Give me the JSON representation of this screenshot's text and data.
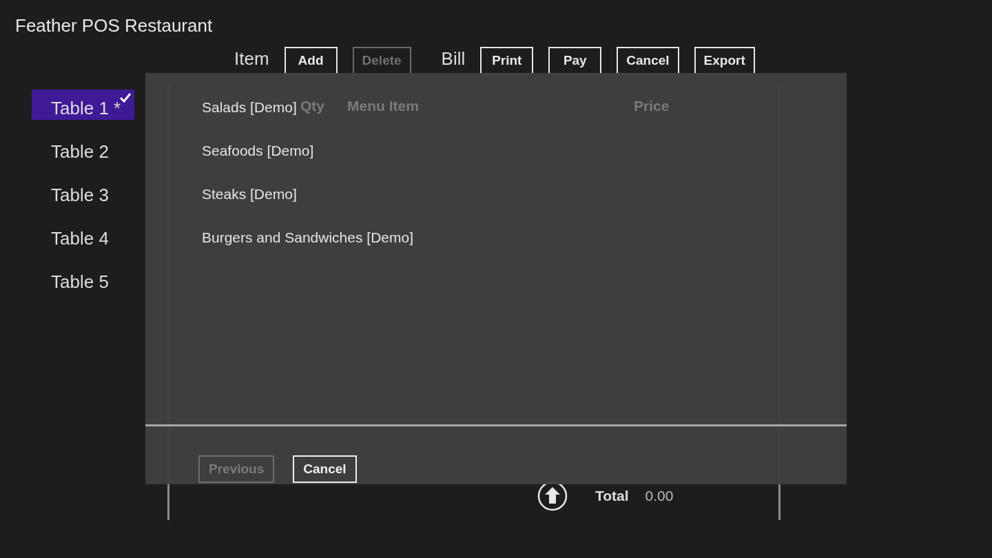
{
  "window": {
    "title": "Feather POS Restaurant"
  },
  "toolbar": {
    "groups": [
      {
        "label": "Item",
        "buttons": [
          {
            "label": "Add",
            "disabled": false
          },
          {
            "label": "Delete",
            "disabled": true
          }
        ]
      },
      {
        "label": "Bill",
        "buttons": [
          {
            "label": "Print",
            "disabled": false
          },
          {
            "label": "Pay",
            "disabled": false
          },
          {
            "label": "Cancel",
            "disabled": false
          },
          {
            "label": "Export",
            "disabled": false
          }
        ]
      }
    ]
  },
  "sidebar": {
    "items": [
      {
        "label": "Table 1 *",
        "selected": true
      },
      {
        "label": "Table 2",
        "selected": false
      },
      {
        "label": "Table 3",
        "selected": false
      },
      {
        "label": "Table 4",
        "selected": false
      },
      {
        "label": "Table 5",
        "selected": false
      }
    ]
  },
  "bill": {
    "columns": [
      "Qty",
      "Menu Item",
      "Price"
    ],
    "total_label": "Total",
    "total_value": "0.00"
  },
  "dialog": {
    "items": [
      "Salads [Demo]",
      "Seafoods [Demo]",
      "Steaks [Demo]",
      "Burgers and Sandwiches [Demo]"
    ],
    "buttons": [
      {
        "label": "Previous",
        "disabled": true
      },
      {
        "label": "Cancel",
        "disabled": false
      }
    ]
  }
}
